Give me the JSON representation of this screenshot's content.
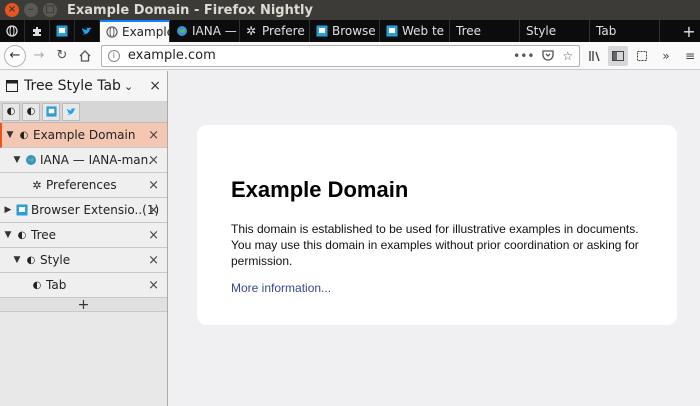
{
  "window": {
    "title": "Example Domain - Firefox Nightly"
  },
  "tabs": [
    {
      "label": "Example",
      "icon": "globe-icon",
      "active": true
    },
    {
      "label": "IANA —",
      "icon": "iana-icon",
      "active": false
    },
    {
      "label": "Prefere",
      "icon": "gear-icon",
      "active": false
    },
    {
      "label": "Browse",
      "icon": "extension-icon",
      "active": false
    },
    {
      "label": "Web te",
      "icon": "extension-icon",
      "active": false
    },
    {
      "label": "Tree",
      "icon": "",
      "active": false
    },
    {
      "label": "Style",
      "icon": "",
      "active": false
    },
    {
      "label": "Tab",
      "icon": "",
      "active": false
    }
  ],
  "new_tab_label": "+",
  "navbar": {
    "url": "example.com"
  },
  "sidebar": {
    "title": "Tree Style Tab",
    "dropdown": "⌄",
    "close": "×",
    "new_tab": "+",
    "items": [
      {
        "label": "Example Domain",
        "twisty": "▼",
        "level": 0,
        "active": true,
        "icon": "globe-icon"
      },
      {
        "label": "IANA — IANA-man..",
        "twisty": "▼",
        "level": 1,
        "active": false,
        "icon": "iana-icon"
      },
      {
        "label": "Preferences",
        "twisty": "",
        "level": 2,
        "active": false,
        "icon": "gear-icon"
      },
      {
        "label": "Browser Extensio..(1)",
        "twisty": "▶",
        "level": 0,
        "active": false,
        "icon": "extension-icon"
      },
      {
        "label": "Tree",
        "twisty": "▼",
        "level": 0,
        "active": false,
        "icon": "globe-icon"
      },
      {
        "label": "Style",
        "twisty": "▼",
        "level": 1,
        "active": false,
        "icon": "globe-icon"
      },
      {
        "label": "Tab",
        "twisty": "",
        "level": 2,
        "active": false,
        "icon": "globe-icon"
      }
    ]
  },
  "page": {
    "heading": "Example Domain",
    "body": "This domain is established to be used for illustrative examples in documents. You may use this domain in examples without prior coordination or asking for permission.",
    "link": "More information..."
  },
  "colors": {
    "accent": "#e95420",
    "tab_highlight": "#0a84ff",
    "link": "#38488f"
  }
}
